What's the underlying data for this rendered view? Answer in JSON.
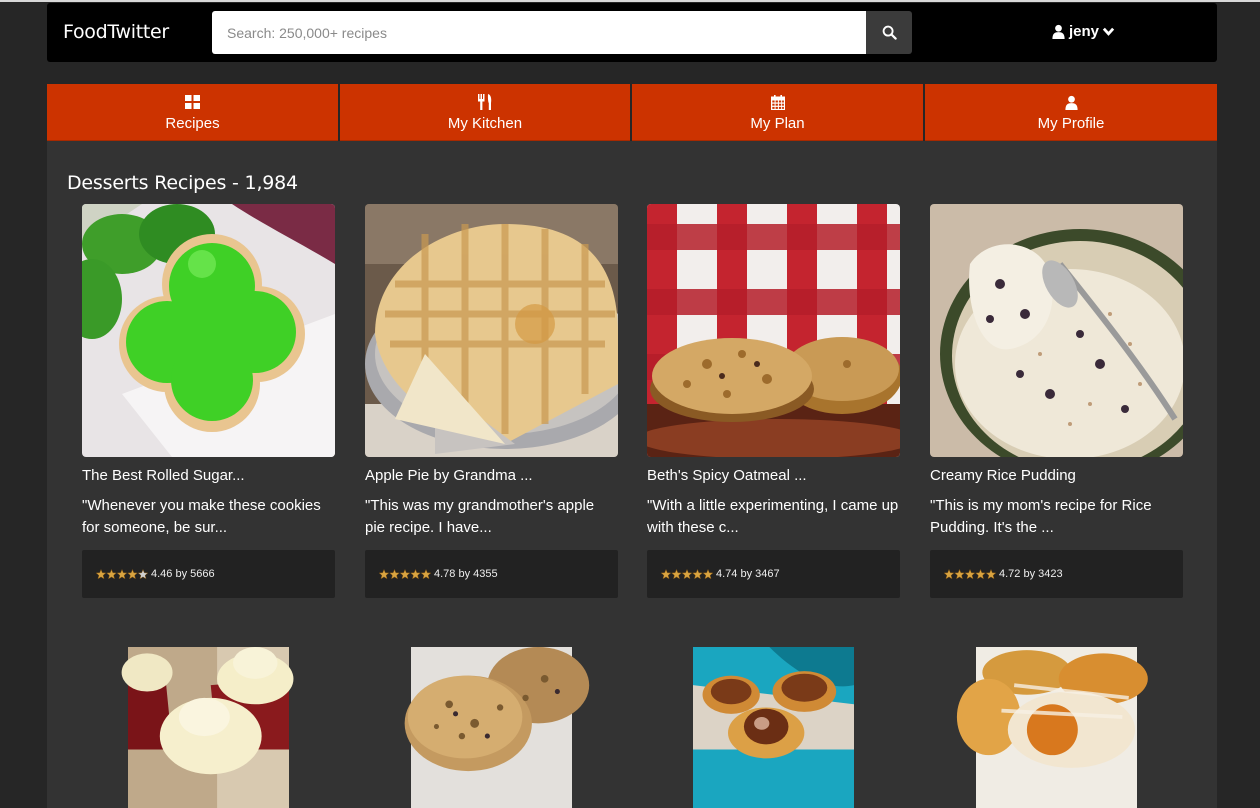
{
  "app": {
    "brand": "FoodTwitter"
  },
  "search": {
    "placeholder": "Search: 250,000+ recipes"
  },
  "user": {
    "name": "jeny"
  },
  "tabs": [
    {
      "label": "Recipes",
      "icon": "grid-icon"
    },
    {
      "label": "My Kitchen",
      "icon": "utensils-icon"
    },
    {
      "label": "My Plan",
      "icon": "calendar-icon"
    },
    {
      "label": "My Profile",
      "icon": "user-icon"
    }
  ],
  "section": {
    "title": "Desserts Recipes - 1,984"
  },
  "recipes": [
    {
      "title": "The Best Rolled Sugar...",
      "description": "\"Whenever you make these cookies for someone, be sur...",
      "rating_text": "4.46 by 5666",
      "rating": 4.46
    },
    {
      "title": "Apple Pie by Grandma ...",
      "description": "\"This was my grandmother's apple pie recipe. I have...",
      "rating_text": "4.78 by 4355",
      "rating": 4.78
    },
    {
      "title": "Beth's Spicy Oatmeal ...",
      "description": "\"With a little experimenting, I came up with these c...",
      "rating_text": "4.74 by 3467",
      "rating": 4.74
    },
    {
      "title": "Creamy Rice Pudding",
      "description": "\"This is my mom's recipe for Rice Pudding. It's the ...",
      "rating_text": "4.72 by 3423",
      "rating": 4.72
    }
  ],
  "colors": {
    "accent": "#cc3300",
    "navbar": "#000000",
    "background": "#262626",
    "content": "#333333",
    "star": "#d9a441"
  }
}
